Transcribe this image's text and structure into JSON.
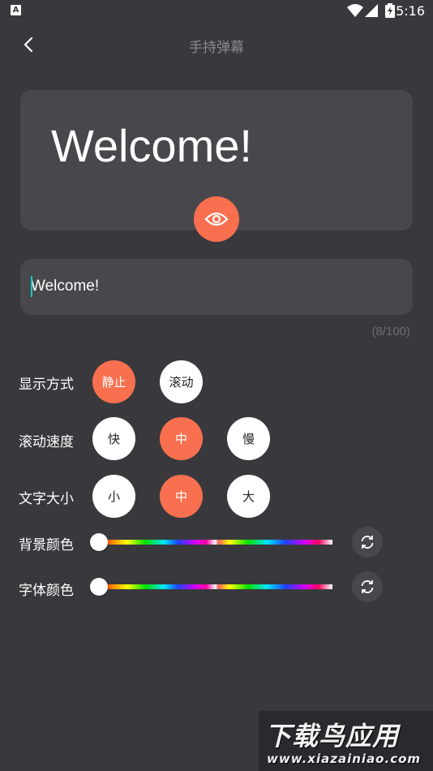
{
  "status_bar": {
    "time": "5:16",
    "badge": "A"
  },
  "header": {
    "title": "手持弹幕"
  },
  "preview": {
    "text": "Welcome!"
  },
  "input": {
    "value": "Welcome!",
    "counter": "(8/100)"
  },
  "display_mode": {
    "label": "显示方式",
    "options": [
      "静止",
      "滚动"
    ],
    "selected": "静止"
  },
  "scroll_speed": {
    "label": "滚动速度",
    "options": [
      "快",
      "中",
      "慢"
    ],
    "selected": "中"
  },
  "text_size": {
    "label": "文字大小",
    "options": [
      "小",
      "中",
      "大"
    ],
    "selected": "中"
  },
  "bg_color": {
    "label": "背景颜色",
    "value": 0
  },
  "font_color": {
    "label": "字体颜色",
    "value": 0
  },
  "colors": {
    "accent": "#f8704f",
    "background": "#39393d",
    "card": "#48484c",
    "cursor": "#1bc6c6"
  },
  "icons": {
    "back": "chevron-left-icon",
    "eye": "eye-icon",
    "refresh": "refresh-icon"
  },
  "watermark": {
    "title": "下载鸟应用",
    "url": "www.xiazainiao.com"
  }
}
